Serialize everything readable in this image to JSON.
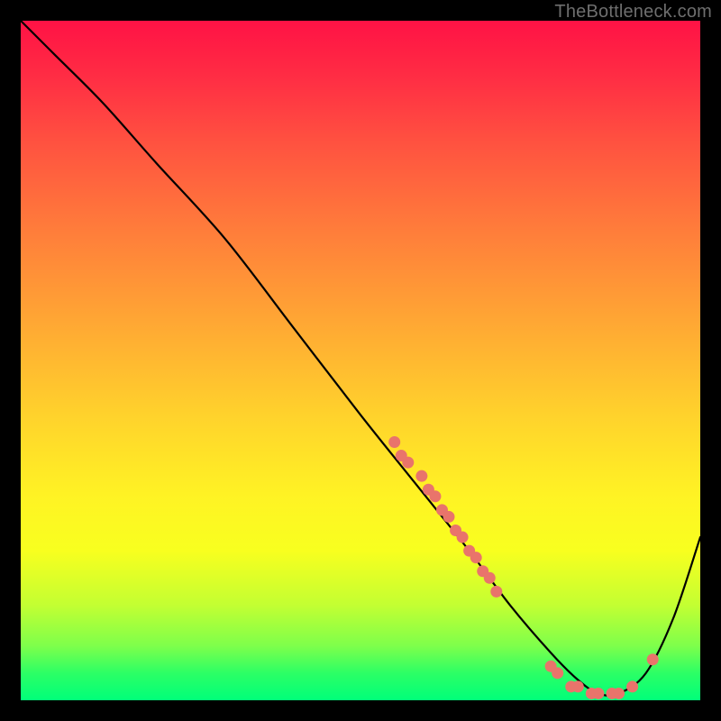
{
  "watermark": "TheBottleneck.com",
  "chart_data": {
    "type": "line",
    "title": "",
    "xlabel": "",
    "ylabel": "",
    "xlim": [
      0,
      100
    ],
    "ylim": [
      0,
      100
    ],
    "grid": false,
    "legend": false,
    "series": [
      {
        "name": "bottleneck-curve",
        "x": [
          0,
          5,
          12,
          20,
          30,
          40,
          50,
          58,
          66,
          72,
          78,
          82,
          85,
          88,
          92,
          96,
          100
        ],
        "y": [
          100,
          95,
          88,
          79,
          68,
          55,
          42,
          32,
          22,
          14,
          7,
          3,
          1,
          1,
          4,
          12,
          24
        ]
      }
    ],
    "point_markers": {
      "name": "highlight-dots",
      "points": [
        {
          "x": 55,
          "y": 38
        },
        {
          "x": 56,
          "y": 36
        },
        {
          "x": 57,
          "y": 35
        },
        {
          "x": 59,
          "y": 33
        },
        {
          "x": 60,
          "y": 31
        },
        {
          "x": 61,
          "y": 30
        },
        {
          "x": 62,
          "y": 28
        },
        {
          "x": 63,
          "y": 27
        },
        {
          "x": 64,
          "y": 25
        },
        {
          "x": 65,
          "y": 24
        },
        {
          "x": 66,
          "y": 22
        },
        {
          "x": 67,
          "y": 21
        },
        {
          "x": 68,
          "y": 19
        },
        {
          "x": 69,
          "y": 18
        },
        {
          "x": 70,
          "y": 16
        },
        {
          "x": 78,
          "y": 5
        },
        {
          "x": 79,
          "y": 4
        },
        {
          "x": 81,
          "y": 2
        },
        {
          "x": 82,
          "y": 2
        },
        {
          "x": 84,
          "y": 1
        },
        {
          "x": 85,
          "y": 1
        },
        {
          "x": 87,
          "y": 1
        },
        {
          "x": 88,
          "y": 1
        },
        {
          "x": 90,
          "y": 2
        },
        {
          "x": 93,
          "y": 6
        }
      ]
    },
    "background_gradient": {
      "top": "#ff1245",
      "bottom": "#00ff7a",
      "stops": [
        "red",
        "orange",
        "yellow",
        "green"
      ]
    }
  }
}
